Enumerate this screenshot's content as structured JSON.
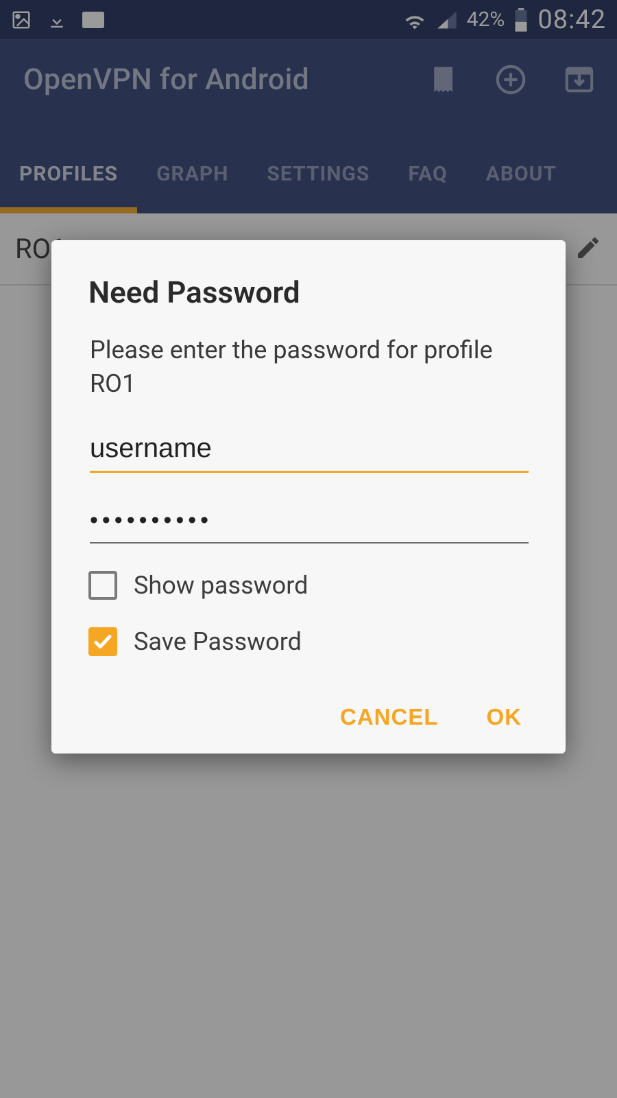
{
  "status_bar": {
    "battery_pct": "42%",
    "time": "08:42"
  },
  "app_bar": {
    "title": "OpenVPN for Android"
  },
  "tabs": [
    {
      "label": "PROFILES",
      "active": true
    },
    {
      "label": "GRAPH",
      "active": false
    },
    {
      "label": "SETTINGS",
      "active": false
    },
    {
      "label": "FAQ",
      "active": false
    },
    {
      "label": "ABOUT",
      "active": false
    }
  ],
  "profiles": {
    "visible_name": "RO1"
  },
  "dialog": {
    "title": "Need Password",
    "message": "Please enter the password for profile RO1",
    "username_value": "username",
    "password_masked": "••••••••••",
    "show_password_label": "Show password",
    "show_password_checked": false,
    "save_password_label": "Save Password",
    "save_password_checked": true,
    "cancel_label": "CANCEL",
    "ok_label": "OK"
  },
  "colors": {
    "accent": "#f5a623",
    "primary": "#304075",
    "status": "#1e2f59"
  }
}
